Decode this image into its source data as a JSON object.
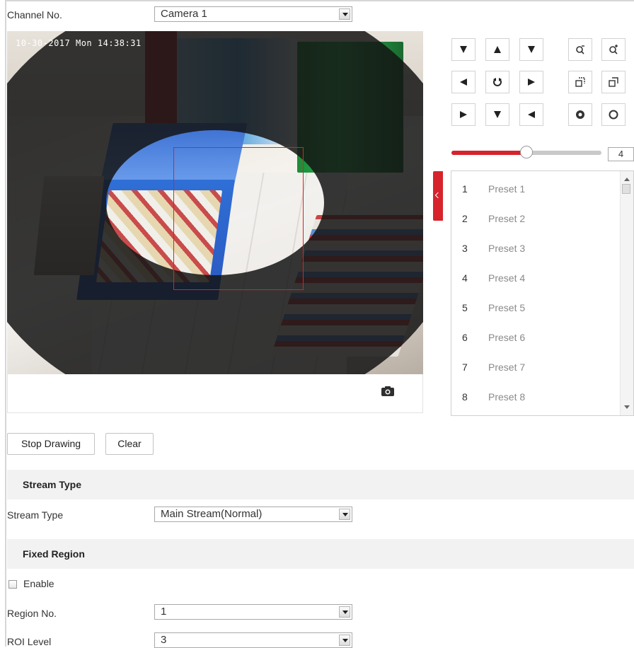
{
  "channel": {
    "label": "Channel No.",
    "value": "Camera 1"
  },
  "video": {
    "osd_time": "10-30-2017 Mon 14:38:31",
    "snapshot_icon": "camera-icon"
  },
  "ptz": {
    "buttons": [
      {
        "name": "ptz-up-left-icon"
      },
      {
        "name": "ptz-up-icon"
      },
      {
        "name": "ptz-up-right-icon"
      },
      {
        "name": "zoom-in-icon"
      },
      {
        "name": "zoom-out-icon"
      },
      {
        "name": "ptz-left-icon"
      },
      {
        "name": "auto-pan-icon"
      },
      {
        "name": "ptz-right-icon"
      },
      {
        "name": "focus-near-icon"
      },
      {
        "name": "focus-far-icon"
      },
      {
        "name": "ptz-down-left-icon"
      },
      {
        "name": "ptz-down-icon"
      },
      {
        "name": "ptz-down-right-icon"
      },
      {
        "name": "iris-open-icon"
      },
      {
        "name": "iris-close-icon"
      }
    ],
    "speed": {
      "value": "4",
      "level_fraction": 0.5
    }
  },
  "presets": [
    {
      "num": "1",
      "name": "Preset 1"
    },
    {
      "num": "2",
      "name": "Preset 2"
    },
    {
      "num": "3",
      "name": "Preset 3"
    },
    {
      "num": "4",
      "name": "Preset 4"
    },
    {
      "num": "5",
      "name": "Preset 5"
    },
    {
      "num": "6",
      "name": "Preset 6"
    },
    {
      "num": "7",
      "name": "Preset 7"
    },
    {
      "num": "8",
      "name": "Preset 8"
    }
  ],
  "actions": {
    "stop_drawing": "Stop Drawing",
    "clear": "Clear"
  },
  "stream_section": {
    "title": "Stream Type",
    "label": "Stream Type",
    "value": "Main Stream(Normal)"
  },
  "fixed_region": {
    "title": "Fixed Region",
    "enable_label": "Enable",
    "enabled": false,
    "region_label": "Region No.",
    "region_value": "1",
    "roi_label": "ROI Level",
    "roi_value": "3"
  },
  "colors": {
    "accent": "#d6232c",
    "roi_box": "#e02020"
  }
}
